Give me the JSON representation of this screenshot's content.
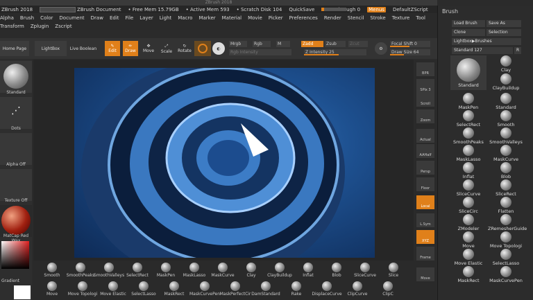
{
  "window": {
    "title": "ZBrush 2018"
  },
  "infobar": {
    "app": "ZBrush 2018",
    "document": "ZBrush Document",
    "free_mem": "• Free Mem 15.79GB",
    "active_mem": "• Active Mem 593",
    "scratch": "• Scratch Disk 104",
    "quicksave": "QuickSave",
    "see_through": "See-through  0",
    "menus": "Menus",
    "script": "DefaultZScript"
  },
  "menu": {
    "row1": [
      "Alpha",
      "Brush",
      "Color",
      "Document",
      "Draw",
      "Edit",
      "File",
      "Layer",
      "Light",
      "Macro",
      "Marker",
      "Material",
      "Movie",
      "Picker",
      "Preferences",
      "Render",
      "Stencil",
      "Stroke",
      "Texture",
      "Tool"
    ],
    "row2": [
      "Transform",
      "Zplugin",
      "Zscript"
    ]
  },
  "toolbar": {
    "home": "Home Page",
    "lightbox": "LightBox",
    "live_boolean": "Live Boolean",
    "edit": "Edit",
    "draw": "Draw",
    "move": "Move",
    "scale": "Scale",
    "rotate": "Rotate",
    "mrgb": "Mrgb",
    "rgb": "Rgb",
    "m": "M",
    "rgb_intensity": "Rgb Intensity",
    "zadd": "Zadd",
    "zsub": "Zsub",
    "zcut": "Zcut",
    "z_intensity": "Z Intensity 25",
    "focal_shift": "Focal Shift 0",
    "draw_size": "Draw Size 64"
  },
  "left": {
    "standard": "Standard",
    "dots": "Dots",
    "alpha": "Alpha Off",
    "texture": "Texture Off",
    "material": "MatCap Red Wax",
    "gradient": "Gradient"
  },
  "rightshelf": [
    "BPR",
    "SPix 3",
    "Scroll",
    "Zoom",
    "Actual",
    "AAHalf",
    "Persp",
    "Floor",
    "Local",
    "L.Sym",
    "XYZ",
    "Frame",
    "Move"
  ],
  "bottom": {
    "row1": [
      "Smooth",
      "SmoothPeaks",
      "SmoothValleys",
      "SelectRect",
      "MaskPen",
      "MaskLasso",
      "MaskCurve",
      "Clay",
      "ClayBuildup",
      "Inflat",
      "Blob",
      "SliceCurve",
      "Slice"
    ],
    "row2": [
      "Move",
      "Move Topologi",
      "Move Elastic",
      "SelectLasso",
      "MaskRect",
      "MaskCurvePen",
      "MaskPerfectCir",
      "DamStandard",
      "Rake",
      "DisplaceCurve",
      "ClipCurve",
      "ClipC"
    ]
  },
  "palette": {
    "title": "Brush",
    "load": "Load Brush",
    "save": "Save As",
    "clone": "Clone",
    "selection": "Selection",
    "lightbox": "Lightbox▶Brushes",
    "standard": "Standard  127",
    "r": "R",
    "items": [
      "Standard",
      "Clay",
      "ClayBuildup",
      "MaskPen",
      "Standard",
      "SelectRect",
      "Smooth",
      "SmoothPeaks",
      "SmoothValleys",
      "MaskLasso",
      "MaskCurve",
      "Inflat",
      "Blob",
      "SliceCurve",
      "SliceRect",
      "SliceCirc",
      "Flatten",
      "ZModeler",
      "ZRemesherGuide",
      "Move",
      "Move Topologi",
      "Move Elastic",
      "SelectLasso",
      "MaskRect",
      "MaskCurvePen"
    ]
  }
}
